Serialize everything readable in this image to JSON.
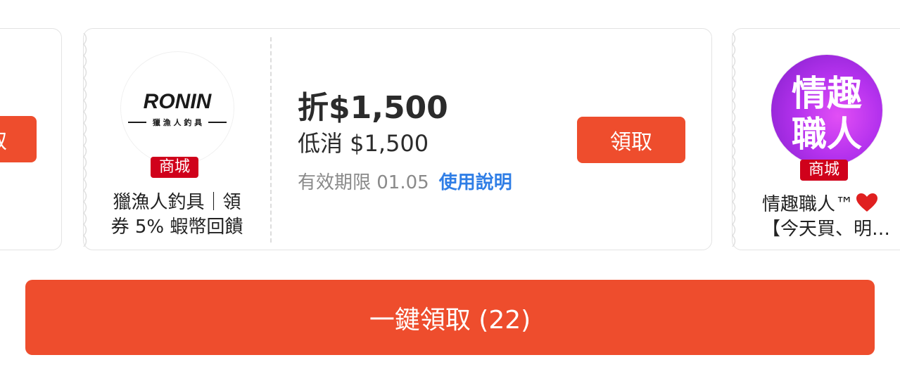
{
  "left_card": {
    "button_label": "取"
  },
  "main_card": {
    "shop": {
      "logo_text": "RONIN",
      "logo_subtext": "獵 漁 人 釣 具",
      "badge": "商城",
      "name_line1": "獵漁人釣具｜領",
      "name_line2": "券 5% 蝦幣回饋"
    },
    "voucher": {
      "discount": "折$1,500",
      "min_spend": "低消 $1,500",
      "validity": "有效期限 01.05",
      "usage_link": "使用說明"
    },
    "claim_label": "領取"
  },
  "right_card": {
    "shop": {
      "logo_line1": "情趣",
      "logo_line2": "職人",
      "badge": "商城",
      "name_line1": "情趣職人™",
      "name_line2": "【今天買、明…"
    }
  },
  "claim_all": {
    "label": "一鍵領取 (22)"
  },
  "colors": {
    "primary": "#ee4d2d",
    "mall_badge": "#d0011b",
    "link": "#2f7ee6"
  }
}
